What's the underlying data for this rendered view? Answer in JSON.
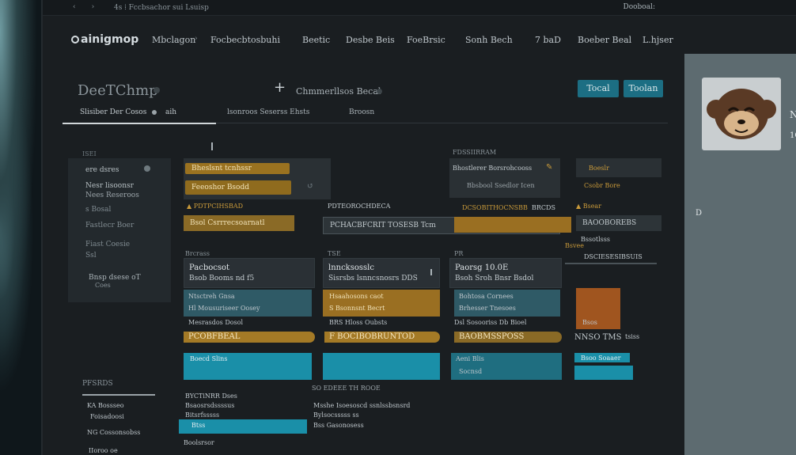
{
  "topbar": {
    "nav_icons": [
      "back-icon",
      "forward-icon"
    ],
    "address": "4s  ⁞  Fccbsachor sui Lsuisp",
    "right_label": "Dooboal:"
  },
  "header": {
    "logo": "ainigmop",
    "nav": [
      "Mbclagon",
      "Focbecbtosbuhi",
      "Beetic",
      "Desbe Beis",
      "FoeBrsic",
      "Sonh Bech",
      "7 baD",
      "Boeber Beal",
      "L.hjser"
    ]
  },
  "titlebar": {
    "title": "DeeTChmp",
    "center_label": "Chmmerllsos Becal",
    "button_primary": "Tocal",
    "button_secondary": "Toolan"
  },
  "subtabs": [
    "Slisiber Der Cosos",
    "aih",
    "lsonroos Seserss Ehsts",
    "Broosn"
  ],
  "sidebar": {
    "caption": "ISEI",
    "items": [
      "ere dsres",
      "Nesr lisoonsr",
      "Nees Reseroos",
      "s Bosal",
      "Fastlecr Boer",
      "Fiast Coesie",
      "Ssl"
    ],
    "footer": "Bnsp dsese oT",
    "footer_sub": "Coes"
  },
  "columns": {
    "col1": {
      "pills": [
        "Bheslsnt tcnhssr",
        "Feeoshor Bsodd"
      ],
      "label_top": "PDTPCIHSBAD",
      "dark_pill": "Bsol Csrrrecsoarnatl",
      "section": "Brcrass",
      "card_title": "Pacbocsot",
      "card_sub": "Bsob Booms nd f5",
      "block_lines": [
        "Ntsctreh Gnsa",
        "Hl Mousuriseer Oosey",
        "Mesrasdos Dosol"
      ],
      "bar": "PCOBFBEAL",
      "teal_label": "Boecd Slins"
    },
    "col2": {
      "label_top": "PDTEOROCHDECA",
      "dark_pill": "PCHACBFCRIT TOSESB Tcm",
      "section": "TSE",
      "card_title": "lnncksosslc",
      "card_sub": "Sisrsbs lsnncsnosrs DDS",
      "block_lines": [
        "Hsaahosons caot",
        "S Bsonnsnt Becrt",
        "BRS Hloss Oubsts"
      ],
      "bar": "F BOCIBOBRUNTOD"
    },
    "col3": {
      "caption": "FDSSIIRRAM",
      "pills": [
        "Bhostlerer Borsrohcooss",
        "Bbsbool Ssedlor Icen"
      ],
      "label_top": "DCSOBITHOCNSBB",
      "dark_pill_right": "BRCDS",
      "section": "PR",
      "card_title": "Paorsg 10.0E",
      "card_sub": "Bsoh Sroh Bnsr Bsdol",
      "block_lines": [
        "Bohtosa Cornees",
        "Brhesser Tnesoes",
        "Dsl Sosooriss Db Bioel"
      ],
      "bar": "BAOBMSSPOSS",
      "teal_lines": [
        "Aeni Blis",
        "Socnsd"
      ]
    },
    "col4": {
      "pills": [
        "Boeslr",
        "Csobr Bore"
      ],
      "label_top": "Bsear",
      "rows": [
        "BAOOBOREBS",
        "Bssotlsss"
      ],
      "label2": "Bsvee",
      "row3": "DSCIESESIBSUIS",
      "block_label": "Bsos",
      "bar": "NNSO TMS",
      "bar_tail": "tsiss",
      "teal_label": "Bsoo Soaaer"
    }
  },
  "bottom": {
    "left_header": "PFSRDS",
    "left_items": [
      "KA Bossseo",
      "Foisadoosi",
      "NG Cossonsobss",
      "IIoroo oe"
    ],
    "mid_header": "",
    "mid_items": [
      "BYCTiNRR Dses",
      "Bsaosrsdssssus",
      "Bitsrfsssss",
      "Btss"
    ],
    "mid_footer": "Boolsrsor",
    "list_header": "SO EDEEE TH ROOE",
    "list_items": [
      "Msshe  Isoesoscd ssnlssbsnsrd",
      "Bylsocsssss ss",
      "Bss Gasonosess"
    ]
  },
  "profile": {
    "initial": "N",
    "sub": "1G",
    "side_letter": "D"
  },
  "colors": {
    "accent_teal": "#1a8fa8",
    "accent_amber": "#a47a26",
    "panel": "#2a3034",
    "background": "#1a1e21"
  }
}
